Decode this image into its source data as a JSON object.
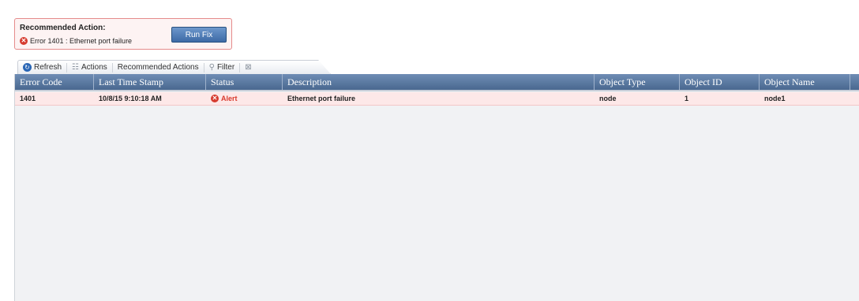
{
  "recommended": {
    "title": "Recommended Action:",
    "message": "Error 1401 : Ethernet port failure",
    "run_fix_label": "Run Fix",
    "icon": "error-icon"
  },
  "toolbar": {
    "refresh_label": "Refresh",
    "actions_label": "Actions",
    "recommended_actions_label": "Recommended Actions",
    "filter_label": "Filter"
  },
  "grid": {
    "columns": [
      "Error Code",
      "Last Time Stamp",
      "Status",
      "Description",
      "Object Type",
      "Object ID",
      "Object Name"
    ],
    "rows": [
      {
        "error_code": "1401",
        "time_stamp": "10/8/15 9:10:18 AM",
        "status": "Alert",
        "description": "Ethernet port failure",
        "object_type": "node",
        "object_id": "1",
        "object_name": "node1"
      }
    ]
  },
  "colors": {
    "header": "#5a7aa3",
    "alert_row": "#fde8e8",
    "alert_text": "#d93a2d",
    "run_fix": "#3d6aa6"
  }
}
